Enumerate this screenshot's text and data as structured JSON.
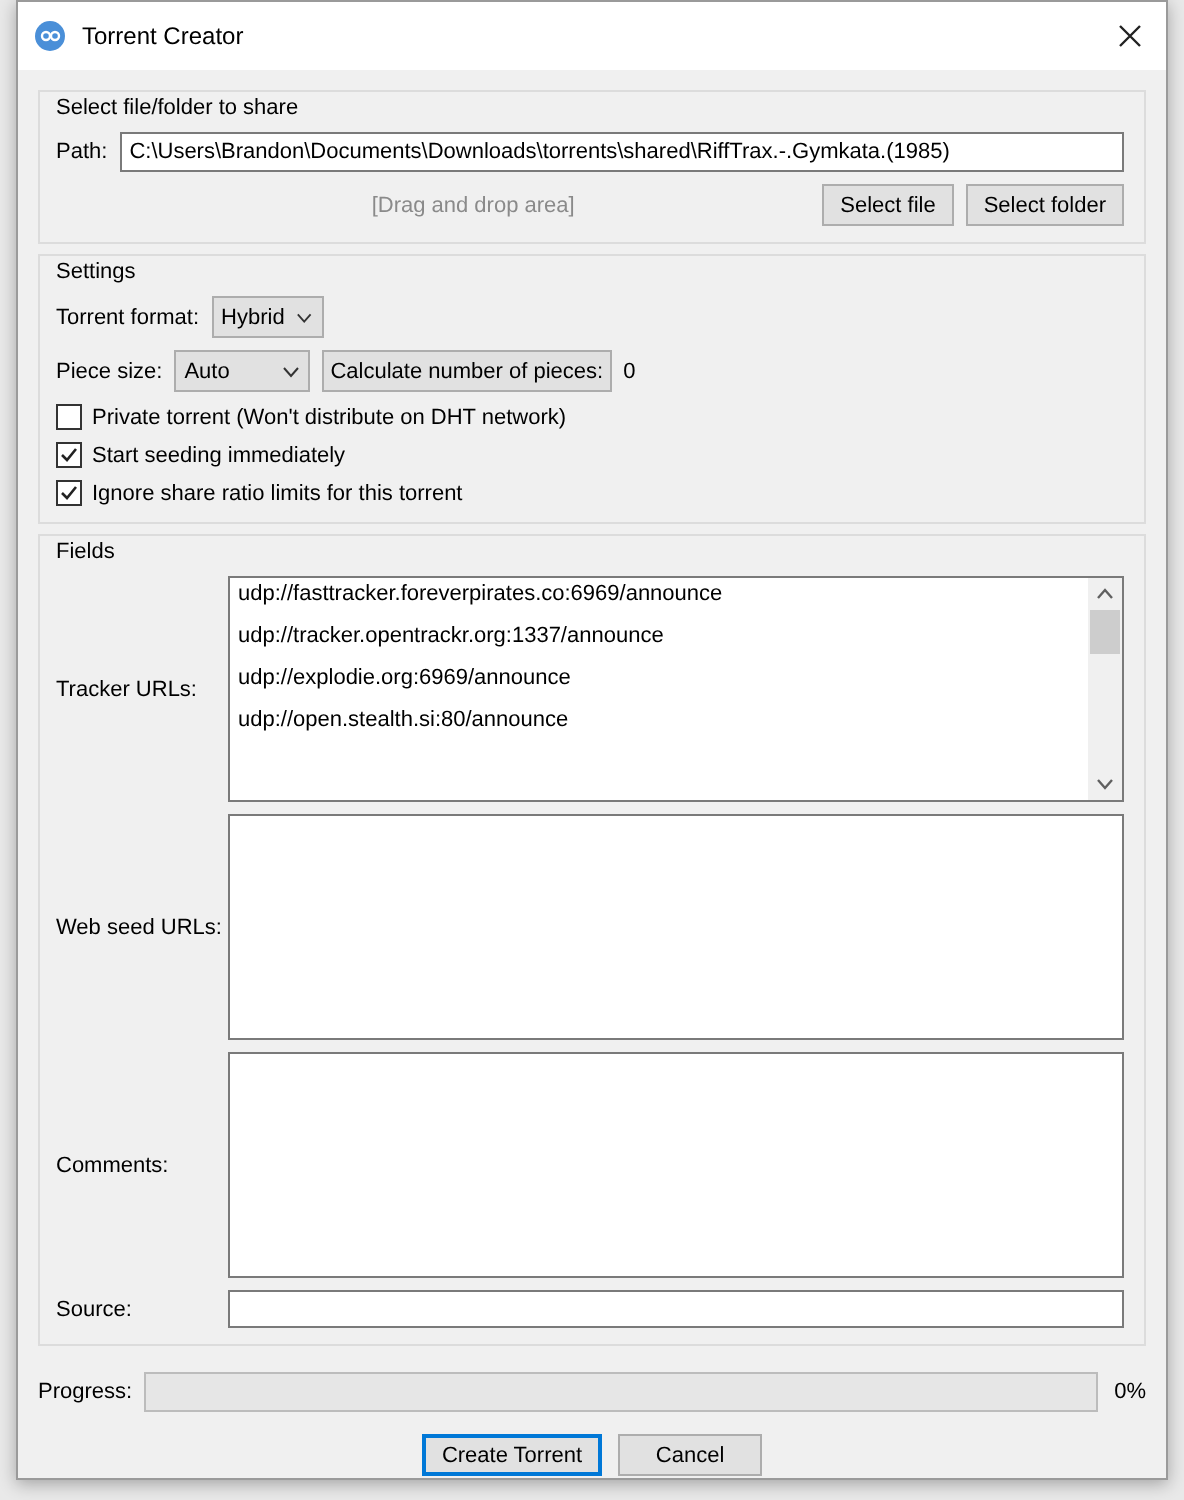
{
  "window": {
    "title": "Torrent Creator"
  },
  "source_group": {
    "title": "Select file/folder to share",
    "path_label": "Path:",
    "path_value": "C:\\Users\\Brandon\\Documents\\Downloads\\torrents\\shared\\RiffTrax.-.Gymkata.(1985)",
    "drop_hint": "[Drag and drop area]",
    "buttons": [
      "Select file",
      "Select folder"
    ]
  },
  "settings": {
    "title": "Settings",
    "format_label": "Torrent format:",
    "format_value": "Hybrid",
    "piece_label": "Piece size:",
    "piece_value": "Auto",
    "calc_button": "Calculate number of pieces:",
    "pieces_count": "0",
    "options": [
      {
        "label": "Private torrent (Won't distribute on DHT network)",
        "checked": false
      },
      {
        "label": "Start seeding immediately",
        "checked": true
      },
      {
        "label": "Ignore share ratio limits for this torrent",
        "checked": true
      }
    ]
  },
  "fields": {
    "title": "Fields",
    "tracker_label": "Tracker URLs:",
    "trackers": [
      "udp://fasttracker.foreverpirates.co:6969/announce",
      "udp://tracker.opentrackr.org:1337/announce",
      "udp://explodie.org:6969/announce",
      "udp://open.stealth.si:80/announce"
    ],
    "web_seed_label": "Web seed URLs:",
    "comments_label": "Comments:",
    "source_label": "Source:"
  },
  "progress": {
    "label": "Progress:",
    "level": 0,
    "reading": "0%"
  },
  "buttons": [
    {
      "label": "Create Torrent",
      "focused": true
    },
    {
      "label": "Cancel",
      "focused": false
    }
  ]
}
